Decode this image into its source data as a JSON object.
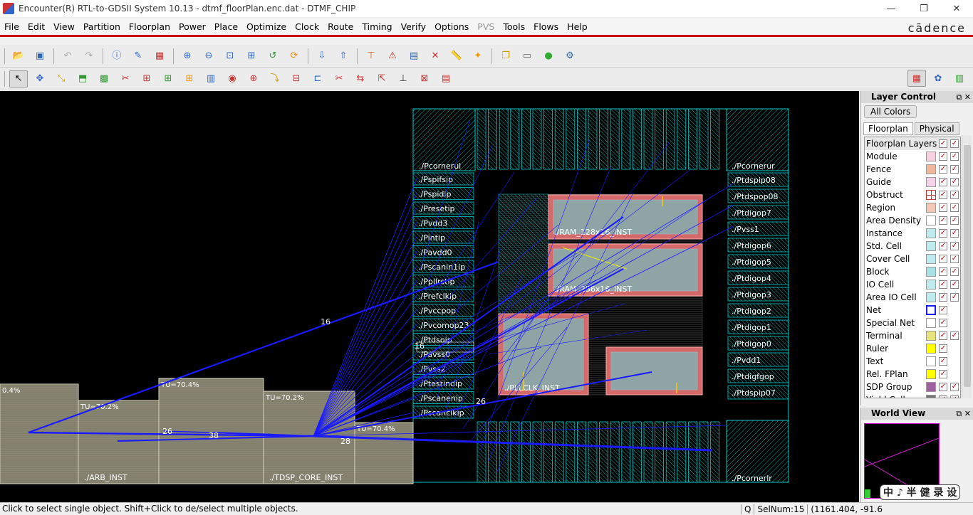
{
  "window": {
    "title": "Encounter(R) RTL-to-GDSII System 10.13 - dtmf_floorPlan.enc.dat - DTMF_CHIP",
    "minimize": "—",
    "restore": "❐",
    "close": "✕"
  },
  "menubar": {
    "items": [
      "File",
      "Edit",
      "View",
      "Partition",
      "Floorplan",
      "Power",
      "Place",
      "Optimize",
      "Clock",
      "Route",
      "Timing",
      "Verify",
      "Options",
      "PVS",
      "Tools",
      "Flows",
      "Help"
    ],
    "logo": "cādence"
  },
  "toolbar1": {
    "icons": [
      "open-icon",
      "save-icon",
      "undo-icon",
      "redo-icon",
      "info-icon",
      "brush-icon",
      "color-pattern-icon",
      "zoom-in-icon",
      "zoom-out-icon",
      "zoom-area-icon",
      "zoom-fit-icon",
      "zoom-previous-icon",
      "redraw-icon",
      "import-icon",
      "export-icon",
      "hierarchy-icon",
      "violation-icon",
      "browser-icon",
      "clear-violation-icon",
      "ruler-icon",
      "highlight-icon",
      "copy-icon",
      "clipboard-icon",
      "globe-icon",
      "settings-icon"
    ]
  },
  "toolbar2": {
    "icons": [
      "select-icon",
      "move-icon",
      "route-icon",
      "resize-icon",
      "module-icon",
      "cut-icon",
      "place-icon",
      "place-block-icon",
      "place-instance-icon",
      "align-icon",
      "block-icon",
      "grid-icon",
      "spacing-icon",
      "floorplan-icon",
      "pin-icon",
      "stretch-icon",
      "scissors-icon",
      "flip-icon",
      "snap-icon",
      "mirror-icon",
      "relative-icon"
    ],
    "right_icons": [
      "floorplan-view-icon",
      "amoeba-view-icon",
      "physical-view-icon"
    ]
  },
  "canvas": {
    "pads_left": [
      "./Pspifsip",
      "./Pspidip",
      "./Presetip",
      "./Pvdd3",
      "./Pintip",
      "./Pavdd0",
      "./Pscanin1ip",
      "./Ppllrstip",
      "./Prefclkip",
      "./Pvccpop",
      "./Pvcomop23",
      "./Ptdsoip",
      "./Pavss0",
      "./Pvss2",
      "./Ptestindip",
      "./Pscanenip",
      "./Pscanclkip"
    ],
    "pads_right": [
      "./Ptdspip08",
      "./Ptdspop08",
      "./Ptdigop7",
      "./Pvss1",
      "./Ptdigop6",
      "./Ptdigop5",
      "./Ptdigop4",
      "./Ptdigop3",
      "./Ptdigop2",
      "./Ptdigop1",
      "./Ptdigop0",
      "./Pvdd1",
      "./Ptdigfgop",
      "./Ptdspip07"
    ],
    "corner_ul": "./Pcornerul",
    "corner_ur": "./Pcornerur",
    "corner_lr": "./Pcornerlr",
    "blocks": {
      "ram1": "./RAM_128x16_INST",
      "ram2": "./RAM_256x16_INST",
      "pll": "./PLLCLK_INST"
    },
    "modules": {
      "arb": "./ARB_INST",
      "tdsp": "./TDSP_CORE_INST",
      "util1": "0.4%",
      "util2": "TU=70.2%",
      "util3": "TU=70.4%",
      "util4": "TU=70.2%",
      "util5": "TU=70.4%"
    },
    "flight_counts": [
      "16",
      "16",
      "26",
      "28",
      "38",
      "26"
    ]
  },
  "layer_control": {
    "title": "Layer Control",
    "all_colors": "All Colors",
    "tabs": [
      "Floorplan",
      "Physical"
    ],
    "header": "Floorplan Layers",
    "layers": [
      {
        "name": "Module",
        "color": "#f6cfe0",
        "checks": 2
      },
      {
        "name": "Fence",
        "color": "#f0b89a",
        "checks": 2
      },
      {
        "name": "Guide",
        "color": "#f4d2ea",
        "checks": 2
      },
      {
        "name": "Obstruct",
        "color": "#ffffff",
        "checks": 2
      },
      {
        "name": "Region",
        "color": "#f3c8b4",
        "checks": 2
      },
      {
        "name": "Area Density",
        "color": "#ffffff",
        "checks": 2
      },
      {
        "name": "Instance",
        "color": "#bfeaf0",
        "checks": 2
      },
      {
        "name": "Std. Cell",
        "color": "#bfeaf0",
        "checks": 2
      },
      {
        "name": "Cover Cell",
        "color": "#bfeaf0",
        "checks": 2
      },
      {
        "name": "Block",
        "color": "#a8e2e6",
        "checks": 2
      },
      {
        "name": "IO Cell",
        "color": "#bfeaf0",
        "checks": 2
      },
      {
        "name": "Area IO Cell",
        "color": "#bfeaf0",
        "checks": 2
      },
      {
        "name": "Net",
        "color": "#1a1aff",
        "checks": 1
      },
      {
        "name": "Special Net",
        "color": "#ffffff",
        "checks": 1
      },
      {
        "name": "Terminal",
        "color": "#e8e27a",
        "checks": 2
      },
      {
        "name": "Ruler",
        "color": "#ffff00",
        "checks": 1
      },
      {
        "name": "Text",
        "color": "#ffffff",
        "checks": 1
      },
      {
        "name": "Rel. FPlan",
        "color": "#ffff00",
        "checks": 1
      },
      {
        "name": "SDP Group",
        "color": "#a060a0",
        "checks": 2
      },
      {
        "name": "Yield Cell",
        "color": "#777777",
        "checks": 2
      }
    ]
  },
  "world_view": {
    "title": "World View"
  },
  "watermark": "中 ♪ 半 健 录 设",
  "status": {
    "message": "Click to select single object. Shift+Click to de/select multiple objects.",
    "q": "Q",
    "selnum": "SelNum:15",
    "coords": "(1161.404, -91.6"
  }
}
